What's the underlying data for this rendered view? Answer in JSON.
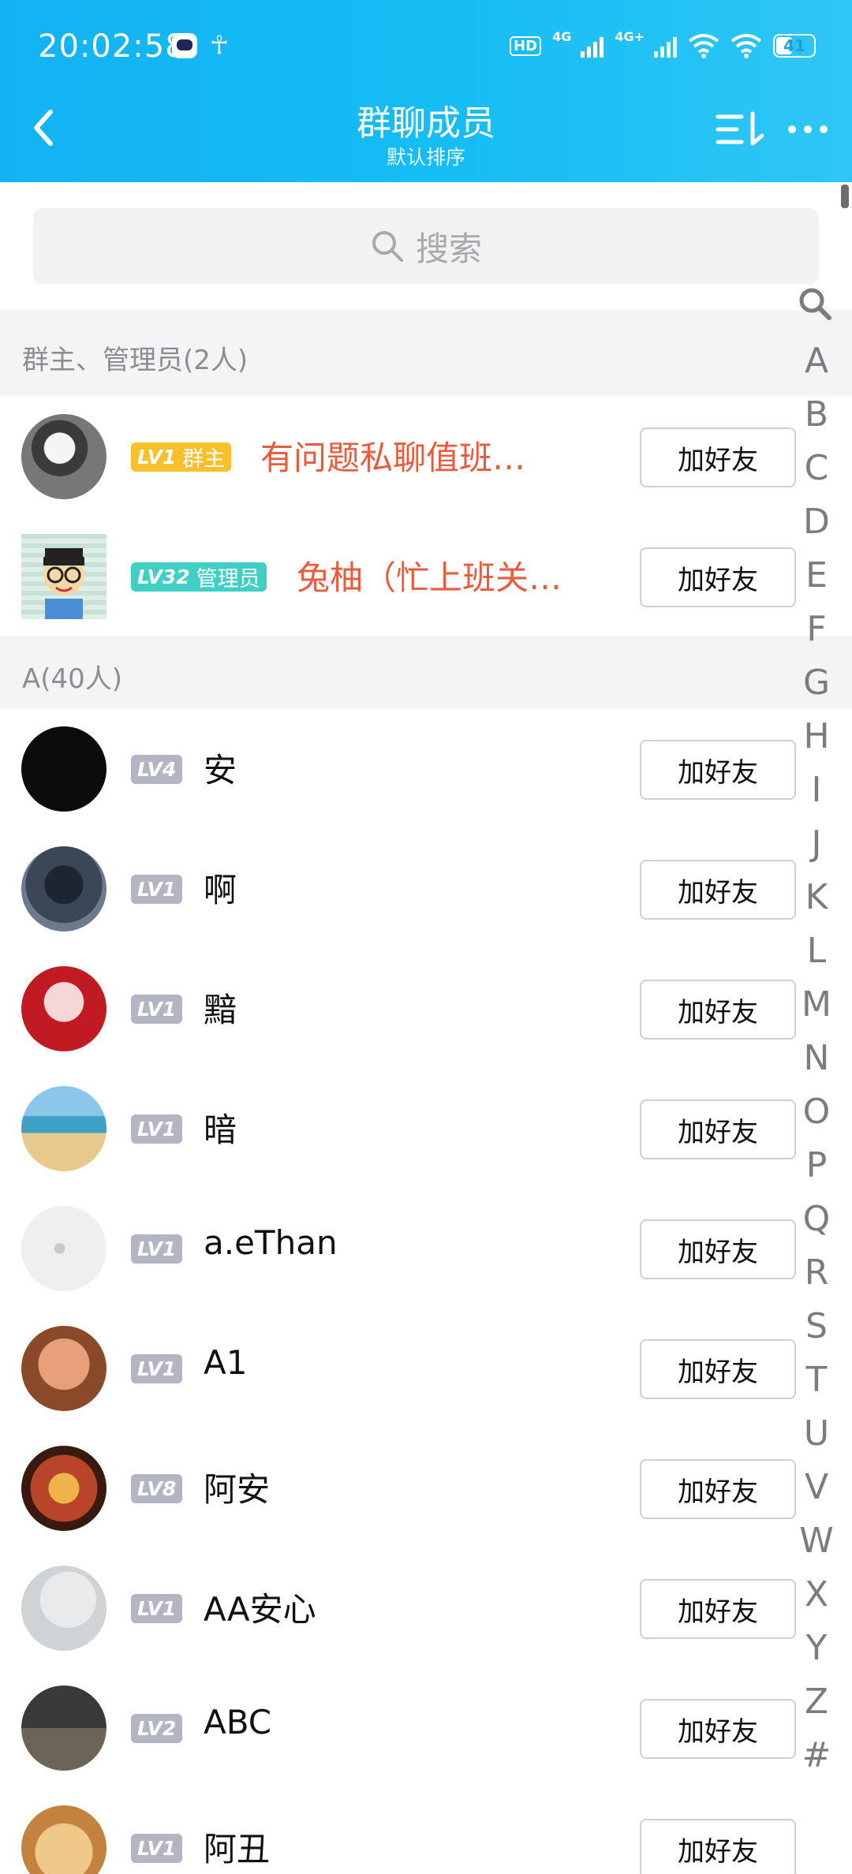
{
  "status_bar": {
    "time": "20:02:58",
    "hd": "HD",
    "net1": "4G",
    "net2": "4G+",
    "battery": "41"
  },
  "nav": {
    "title": "群聊成员",
    "subtitle": "默认排序"
  },
  "search": {
    "placeholder": "搜索"
  },
  "sections": [
    {
      "label": "群主、管理员(2人)"
    },
    {
      "label": "A(40人)"
    }
  ],
  "admins": [
    {
      "level": "LV1",
      "role": "群主",
      "badge_color": "#f7c02c",
      "name": "有问题私聊值班…",
      "name_color": "#ea5a3d",
      "add": "加好友"
    },
    {
      "level": "LV32",
      "role": "管理员",
      "badge_color": "#3fcfc5",
      "name": "兔柚（忙上班关…",
      "name_color": "#ea5a3d",
      "add": "加好友"
    }
  ],
  "members": [
    {
      "level": "LV4",
      "name": "安",
      "add": "加好友"
    },
    {
      "level": "LV1",
      "name": "啊",
      "add": "加好友"
    },
    {
      "level": "LV1",
      "name": "黯",
      "add": "加好友"
    },
    {
      "level": "LV1",
      "name": "暗",
      "add": "加好友"
    },
    {
      "level": "LV1",
      "name": "a.eThan",
      "add": "加好友"
    },
    {
      "level": "LV1",
      "name": "A1",
      "add": "加好友"
    },
    {
      "level": "LV8",
      "name": "阿安",
      "add": "加好友"
    },
    {
      "level": "LV1",
      "name": "AA安心",
      "add": "加好友"
    },
    {
      "level": "LV2",
      "name": "ABC",
      "add": "加好友"
    },
    {
      "level": "LV1",
      "name": "阿丑",
      "add": "加好友"
    }
  ],
  "index_letters": [
    "A",
    "B",
    "C",
    "D",
    "E",
    "F",
    "G",
    "H",
    "I",
    "J",
    "K",
    "L",
    "M",
    "N",
    "O",
    "P",
    "Q",
    "R",
    "S",
    "T",
    "U",
    "V",
    "W",
    "X",
    "Y",
    "Z",
    "#"
  ],
  "colors": {
    "header": "#16bdf4",
    "member_badge": "#b3b5c2",
    "admin_name": "#ea5a3d"
  }
}
